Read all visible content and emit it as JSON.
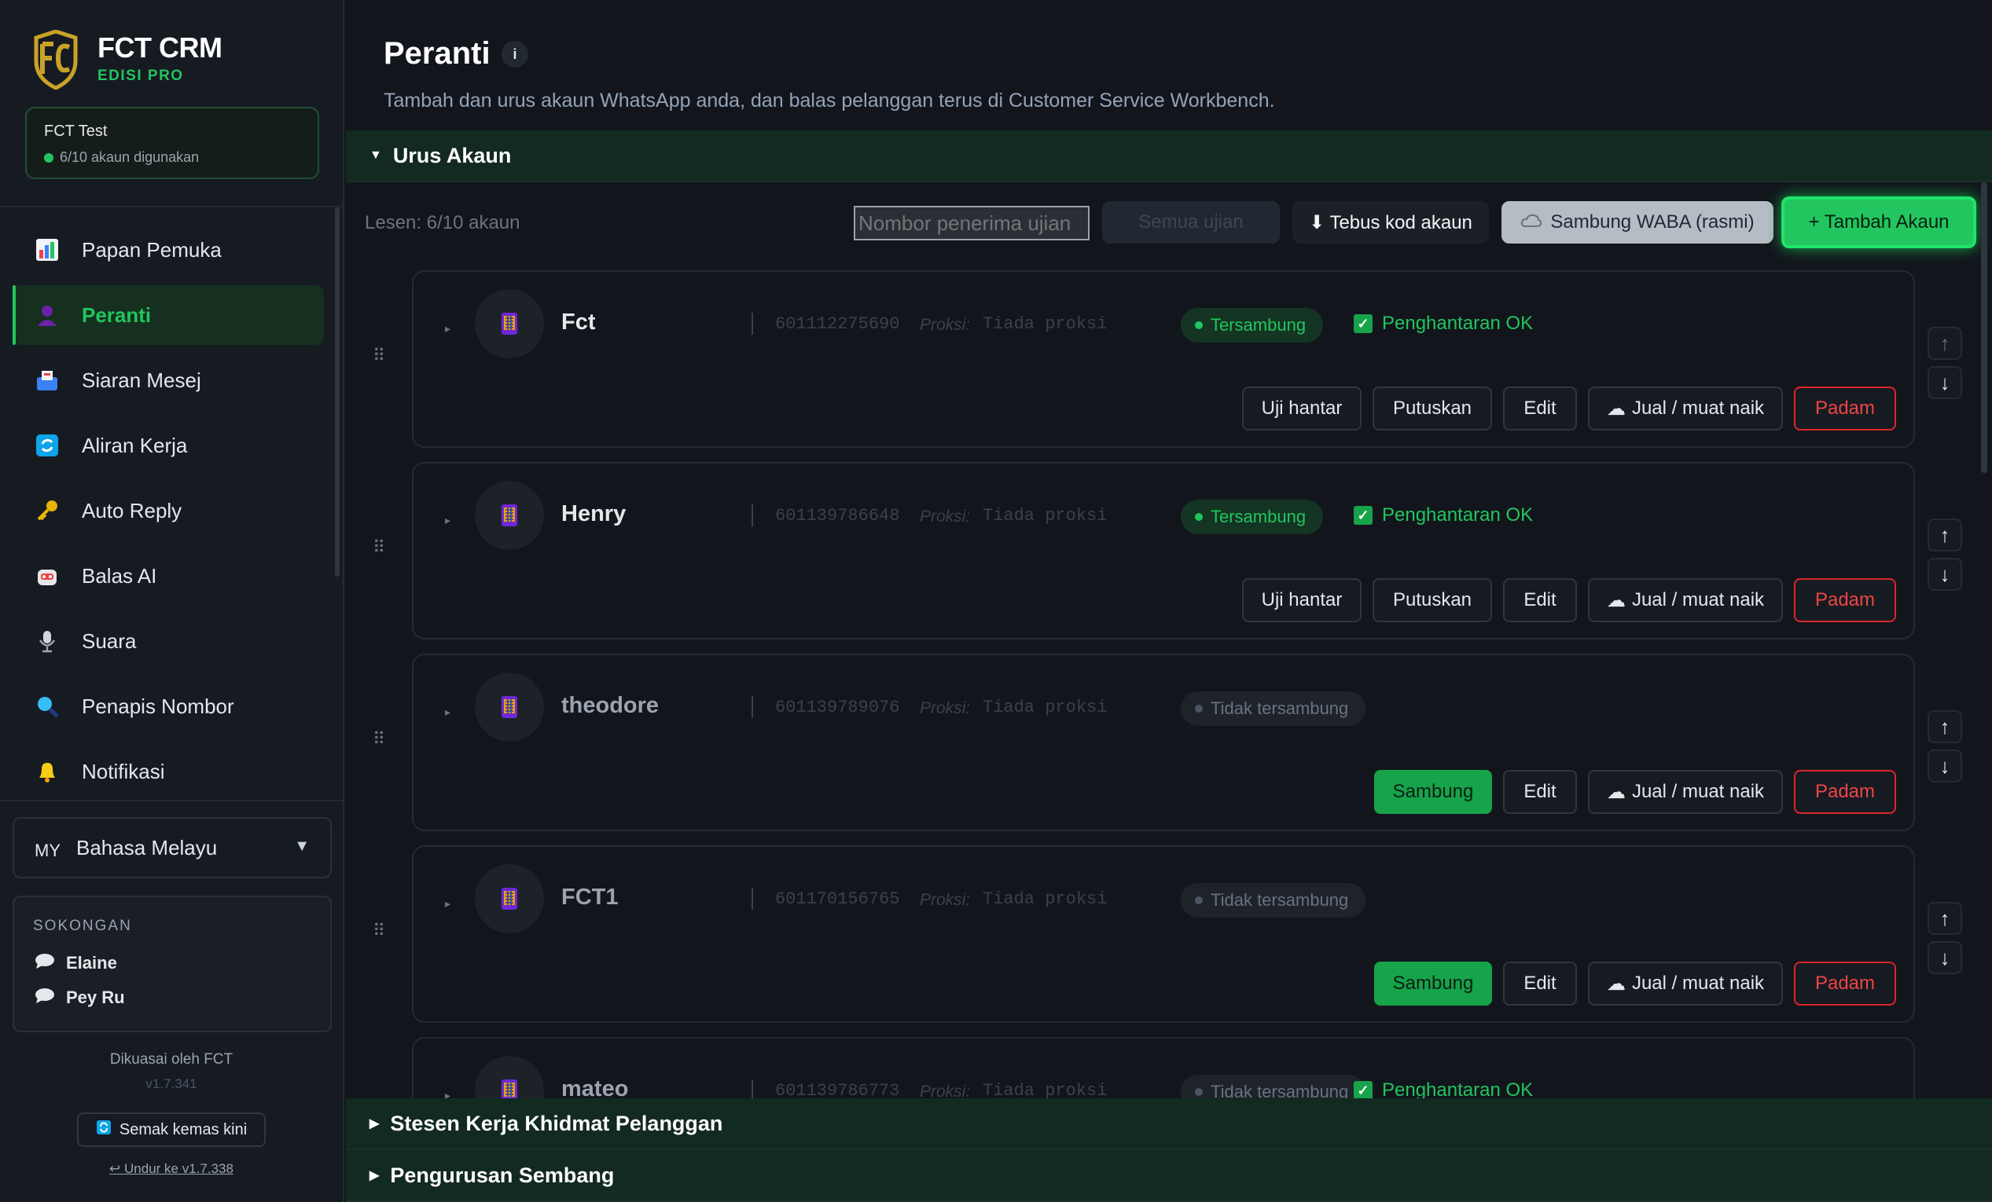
{
  "brand": {
    "name": "FCT CRM",
    "edition": "EDISI PRO"
  },
  "workspace": {
    "name": "FCT Test",
    "usage": "6/10 akaun digunakan"
  },
  "nav": [
    {
      "label": "Papan Pemuka",
      "icon": "chart-icon"
    },
    {
      "label": "Peranti",
      "icon": "person-icon",
      "active": true
    },
    {
      "label": "Siaran Mesej",
      "icon": "inbox-icon"
    },
    {
      "label": "Aliran Kerja",
      "icon": "refresh-icon"
    },
    {
      "label": "Auto Reply",
      "icon": "key-icon"
    },
    {
      "label": "Balas AI",
      "icon": "robot-icon"
    },
    {
      "label": "Suara",
      "icon": "microphone-icon"
    },
    {
      "label": "Penapis Nombor",
      "icon": "magnifier-icon"
    },
    {
      "label": "Notifikasi",
      "icon": "bell-icon"
    }
  ],
  "language": {
    "code": "MY",
    "label": "Bahasa Melayu"
  },
  "support": {
    "title": "SOKONGAN",
    "contacts": [
      "Elaine",
      "Pey Ru"
    ]
  },
  "footer": {
    "powered": "Dikuasai oleh FCT",
    "version": "v1.7.341",
    "check_update": "Semak kemas kini",
    "rollback": "↩ Undur ke v1.7.338"
  },
  "page": {
    "title": "Peranti",
    "description": "Tambah dan urus akaun WhatsApp anda, dan balas pelanggan terus di Customer Service Workbench."
  },
  "sections": {
    "manage": "Urus Akaun",
    "workbench": "Stesen Kerja Khidmat Pelanggan",
    "admin": "Pengurusan Sembang"
  },
  "toolbar": {
    "license": "Lesen: 6/10 akaun",
    "test_placeholder": "Nombor penerima ujian",
    "disabled_btn": "Semua ujian",
    "redeem": "⬇ Tebus kod akaun",
    "waba": "Sambung WABA (rasmi)",
    "add": "+ Tambah Akaun"
  },
  "proxy_label": "Proksi:",
  "accounts": [
    {
      "name": "Fct",
      "number": "601112275690",
      "proxy": "Tiada proksi",
      "status": "Tersambung",
      "connected": true,
      "delivery": "Penghantaran OK"
    },
    {
      "name": "Henry",
      "number": "601139786648",
      "proxy": "Tiada proksi",
      "status": "Tersambung",
      "connected": true,
      "delivery": "Penghantaran OK"
    },
    {
      "name": "theodore",
      "number": "601139789076",
      "proxy": "Tiada proksi",
      "status": "Tidak tersambung",
      "connected": false
    },
    {
      "name": "FCT1",
      "number": "601170156765",
      "proxy": "Tiada proksi",
      "status": "Tidak tersambung",
      "connected": false
    },
    {
      "name": "mateo",
      "number": "601139786773",
      "proxy": "Tiada proksi",
      "status": "Tidak tersambung",
      "connected": false,
      "delivery": "Penghantaran OK"
    }
  ],
  "actions": {
    "test": "Uji hantar",
    "disconnect": "Putuskan",
    "connect": "Sambung",
    "edit": "Edit",
    "sell": "Jual / muat naik",
    "delete": "Padam"
  },
  "colors": {
    "accent": "#22c55e",
    "danger": "#ef4444",
    "sidebar": "#161b22",
    "background": "#12161c"
  }
}
